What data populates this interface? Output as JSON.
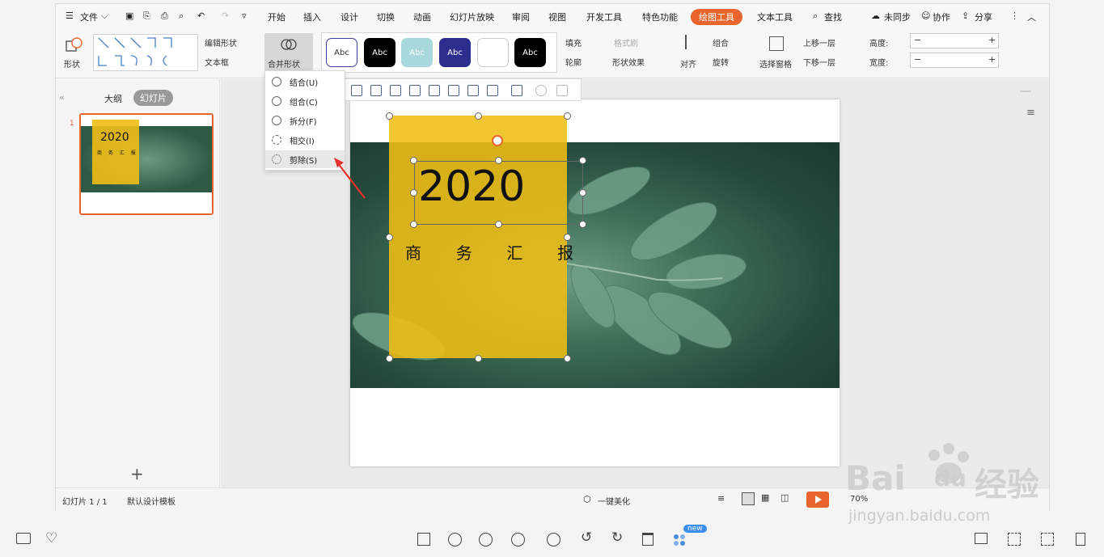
{
  "menubar": {
    "file": "文件",
    "tabs": [
      "开始",
      "插入",
      "设计",
      "切换",
      "动画",
      "幻灯片放映",
      "审阅",
      "视图",
      "开发工具",
      "特色功能"
    ],
    "active_tab": "绘图工具",
    "text_tool": "文本工具",
    "search": "查找",
    "sync": "未同步",
    "collab": "协作",
    "share": "分享"
  },
  "ribbon": {
    "shape": "形状",
    "edit_shape": "编辑形状",
    "textbox": "文本框",
    "merge_shape": "合并形状",
    "styles": [
      "Abc",
      "Abc",
      "Abc",
      "Abc",
      "",
      "Abc"
    ],
    "fill": "填充",
    "format_painter": "格式刷",
    "outline": "轮廓",
    "shape_effect": "形状效果",
    "align": "对齐",
    "group": "组合",
    "rotate": "旋转",
    "selection_pane": "选择窗格",
    "bring_forward": "上移一层",
    "send_backward": "下移一层",
    "height_label": "高度:",
    "width_label": "宽度:"
  },
  "dropdown": {
    "items": [
      "结合(U)",
      "组合(C)",
      "拆分(F)",
      "相交(I)",
      "剪除(S)"
    ]
  },
  "left_panel": {
    "outline_tab": "大纲",
    "slides_tab": "幻灯片",
    "slide_number": "1",
    "thumb_year": "2020",
    "thumb_sub": "商 务 汇 报",
    "add": "+"
  },
  "slide": {
    "year": "2020",
    "subtitle": "商  务  汇  报"
  },
  "statusbar": {
    "slide_info": "幻灯片 1 / 1",
    "template": "默认设计模板",
    "beautify": "一键美化",
    "zoom": "70%"
  },
  "bottom": {
    "new_badge": "new"
  },
  "watermark": {
    "brand": "Bai",
    "paw": "du",
    "jingyan": "经验",
    "url": "jingyan.baidu.com"
  },
  "colors": {
    "accent": "#e8652e",
    "yellow": "#f0be14",
    "leaf_dark": "#244a3a"
  }
}
